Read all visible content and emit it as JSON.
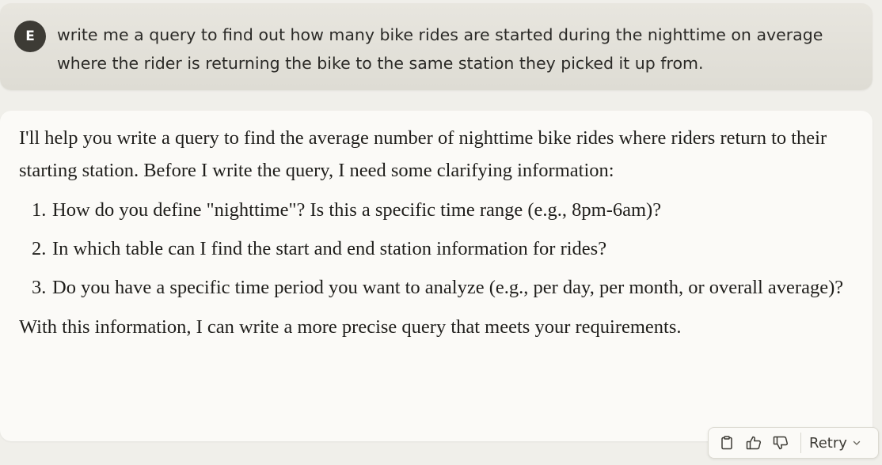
{
  "user_message": {
    "avatar_initial": "E",
    "text": "write me a query to find out how many bike rides are started during the nighttime on average where the rider is returning the bike to the same station they picked it up from."
  },
  "assistant_message": {
    "intro": "I'll help you write a query to find the average number of nighttime bike rides where riders return to their starting station. Before I write the query, I need some clarifying information:",
    "questions": [
      {
        "number": "1.",
        "text": "How do you define \"nighttime\"? Is this a specific time range (e.g., 8pm-6am)?"
      },
      {
        "number": "2.",
        "text": "In which table can I find the start and end station information for rides?"
      },
      {
        "number": "3.",
        "text": "Do you have a specific time period you want to analyze (e.g., per day, per month, or overall average)?"
      }
    ],
    "closing": "With this information, I can write a more precise query that meets your requirements."
  },
  "toolbar": {
    "copy_icon": "clipboard-icon",
    "thumbs_up_icon": "thumbs-up-icon",
    "thumbs_down_icon": "thumbs-down-icon",
    "retry_label": "Retry",
    "retry_chevron": "chevron-down-icon"
  },
  "colors": {
    "page_background": "#f0efea",
    "user_bubble": "#e3e1da",
    "assistant_bubble": "#fbfaf7",
    "avatar": "#3d3b35",
    "text": "#1f1e1b"
  }
}
